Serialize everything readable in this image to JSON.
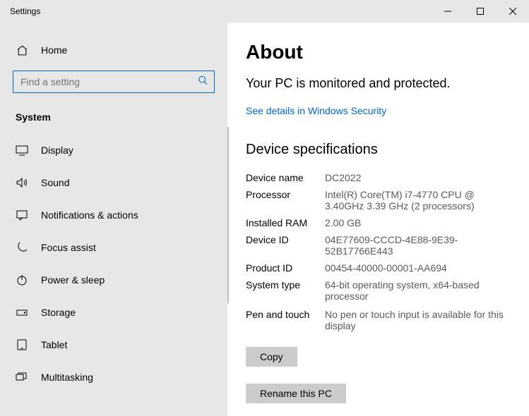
{
  "window": {
    "title": "Settings"
  },
  "sidebar": {
    "home_label": "Home",
    "search_placeholder": "Find a setting",
    "section_label": "System",
    "items": [
      {
        "label": "Display"
      },
      {
        "label": "Sound"
      },
      {
        "label": "Notifications & actions"
      },
      {
        "label": "Focus assist"
      },
      {
        "label": "Power & sleep"
      },
      {
        "label": "Storage"
      },
      {
        "label": "Tablet"
      },
      {
        "label": "Multitasking"
      }
    ]
  },
  "content": {
    "title": "About",
    "status": "Your PC is monitored and protected.",
    "security_link": "See details in Windows Security",
    "spec_heading": "Device specifications",
    "specs": {
      "device_name_label": "Device name",
      "device_name_value": "DC2022",
      "processor_label": "Processor",
      "processor_value": "Intel(R) Core(TM) i7-4770 CPU @ 3.40GHz 3.39 GHz  (2 processors)",
      "ram_label": "Installed RAM",
      "ram_value": "2.00 GB",
      "device_id_label": "Device ID",
      "device_id_value": "04E77609-CCCD-4E88-9E39-52B17766E443",
      "product_id_label": "Product ID",
      "product_id_value": "00454-40000-00001-AA694",
      "system_type_label": "System type",
      "system_type_value": "64-bit operating system, x64-based processor",
      "pen_touch_label": "Pen and touch",
      "pen_touch_value": "No pen or touch input is available for this display"
    },
    "copy_button": "Copy",
    "rename_button": "Rename this PC"
  }
}
